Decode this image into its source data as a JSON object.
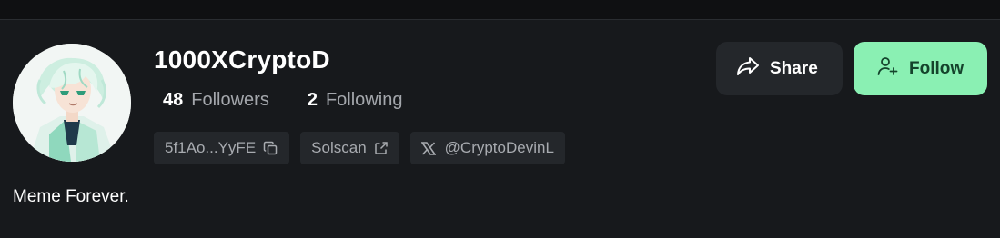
{
  "profile": {
    "username": "1000XCryptoD",
    "followers": {
      "count": "48",
      "label": "Followers"
    },
    "following": {
      "count": "2",
      "label": "Following"
    },
    "address": "5f1Ao...YyFE",
    "solscan_label": "Solscan",
    "twitter_handle": "@CryptoDevinL",
    "bio": "Meme Forever."
  },
  "actions": {
    "share_label": "Share",
    "follow_label": "Follow"
  },
  "icons": {
    "copy": "copy-icon",
    "external": "external-link-icon",
    "x": "x-logo-icon",
    "share": "share-icon",
    "follow": "user-plus-icon"
  },
  "colors": {
    "background": "#17191c",
    "chip": "#24272b",
    "follow_button": "#8af0b3",
    "muted_text": "#a4a7ac"
  }
}
